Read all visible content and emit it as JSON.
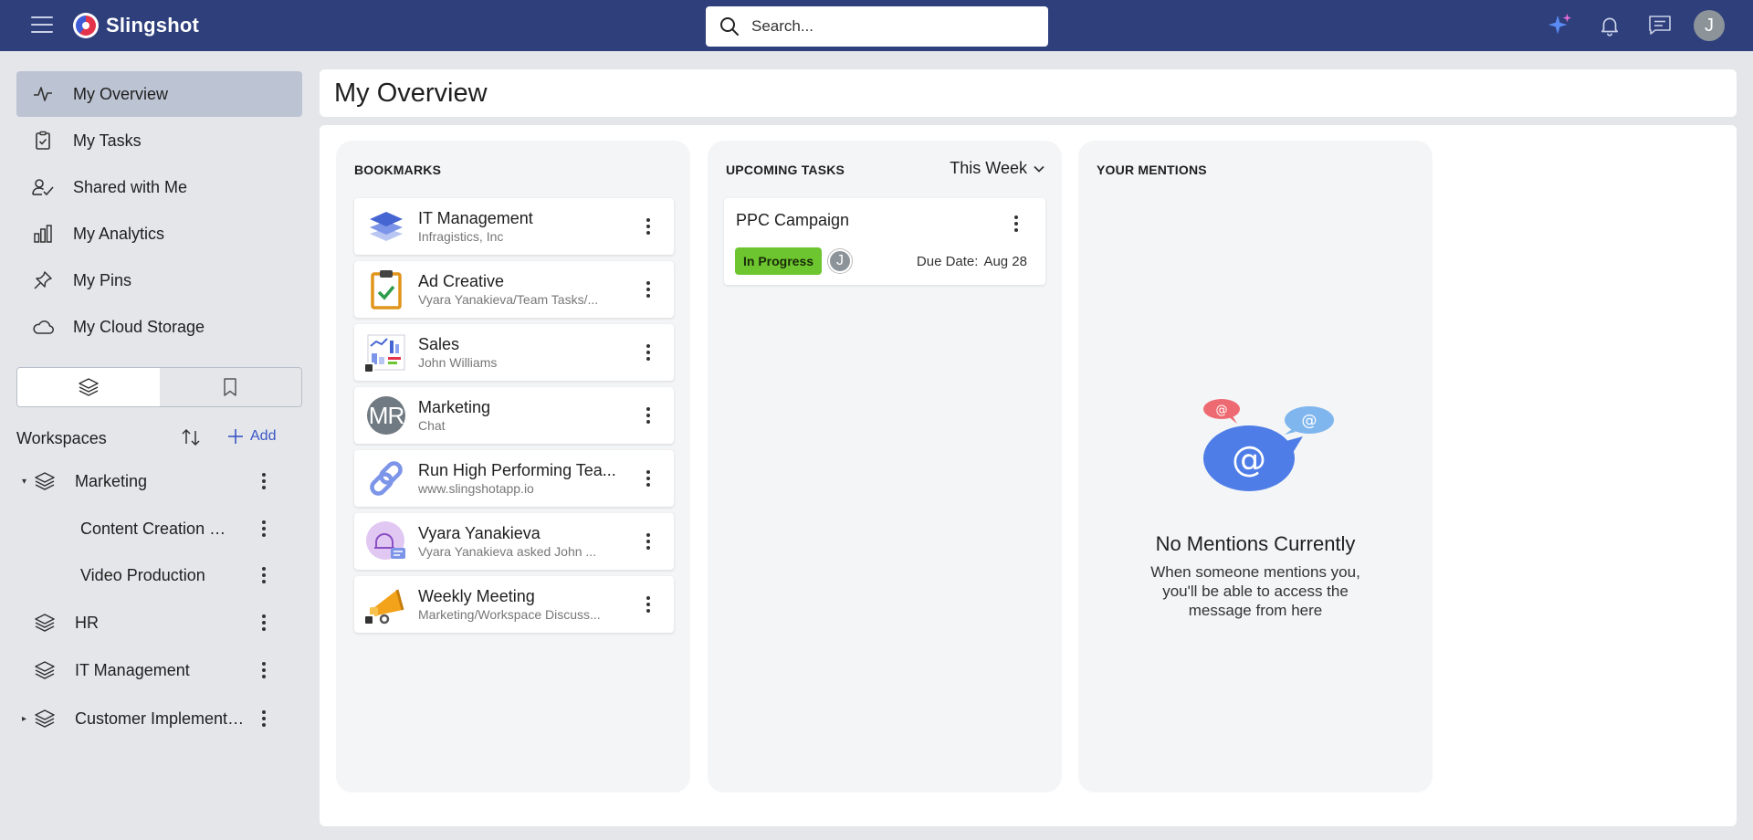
{
  "app": {
    "name": "Slingshot"
  },
  "search": {
    "placeholder": "Search..."
  },
  "user": {
    "initial": "J"
  },
  "nav": {
    "items": [
      {
        "label": "My Overview",
        "icon": "activity-icon"
      },
      {
        "label": "My Tasks",
        "icon": "clipboard-check-icon"
      },
      {
        "label": "Shared with Me",
        "icon": "user-check-icon"
      },
      {
        "label": "My Analytics",
        "icon": "bar-chart-icon"
      },
      {
        "label": "My Pins",
        "icon": "pin-icon"
      },
      {
        "label": "My Cloud Storage",
        "icon": "cloud-icon"
      }
    ]
  },
  "workspaces": {
    "title": "Workspaces",
    "add_label": "Add",
    "items": [
      {
        "label": "Marketing",
        "expanded": true
      },
      {
        "label": "Content Creation an...",
        "sub": true
      },
      {
        "label": "Video Production",
        "sub": true
      },
      {
        "label": "HR"
      },
      {
        "label": "IT Management"
      },
      {
        "label": "Customer Implementa...",
        "expanded": false
      }
    ]
  },
  "page": {
    "title": "My Overview"
  },
  "bookmarks": {
    "title": "BOOKMARKS",
    "items": [
      {
        "name": "IT Management",
        "sub": "Infragistics, Inc",
        "icon": "layers-icon"
      },
      {
        "name": "Ad Creative",
        "sub": "Vyara Yanakieva/Team Tasks/...",
        "icon": "clipboard-icon"
      },
      {
        "name": "Sales",
        "sub": "John Williams",
        "icon": "dashboard-icon"
      },
      {
        "name": "Marketing",
        "sub": "Chat",
        "icon": "avatar-mr-icon",
        "initials": "MR"
      },
      {
        "name": "Run High Performing Tea...",
        "sub": "www.slingshotapp.io",
        "icon": "link-icon"
      },
      {
        "name": "Vyara Yanakieva",
        "sub": "Vyara Yanakieva asked John ...",
        "icon": "chat-bell-icon"
      },
      {
        "name": "Weekly Meeting",
        "sub": "Marketing/Workspace Discuss...",
        "icon": "megaphone-icon"
      }
    ]
  },
  "tasks": {
    "title": "UPCOMING TASKS",
    "period": "This Week",
    "items": [
      {
        "name": "PPC Campaign",
        "status": "In Progress",
        "assignee": "J",
        "due_label": "Due Date:",
        "due_date": "Aug 28"
      }
    ]
  },
  "mentions": {
    "title": "YOUR MENTIONS",
    "empty_title": "No Mentions Currently",
    "empty_desc": "When someone mentions you, you'll be able to access the message from here"
  },
  "colors": {
    "topbar": "#2e3f7c",
    "accent": "#3a56c5",
    "status_in_progress": "#6dc62f"
  }
}
